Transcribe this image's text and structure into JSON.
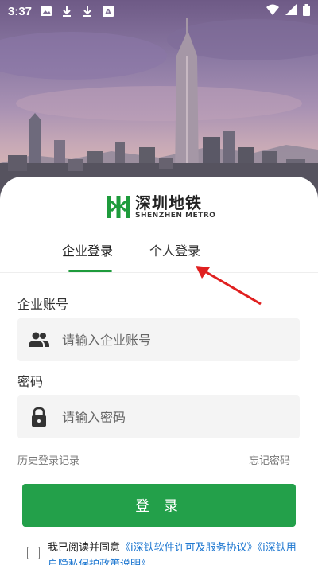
{
  "status_bar": {
    "time": "3:37"
  },
  "logo": {
    "name_cn": "深圳地铁",
    "name_en": "SHENZHEN METRO"
  },
  "tabs": [
    {
      "label": "企业登录",
      "active": true
    },
    {
      "label": "个人登录",
      "active": false
    }
  ],
  "form": {
    "account_label": "企业账号",
    "account_placeholder": "请输入企业账号",
    "password_label": "密码",
    "password_placeholder": "请输入密码"
  },
  "links": {
    "history": "历史登录记录",
    "forgot": "忘记密码"
  },
  "login_button": "登 录",
  "agreement": {
    "prefix": "我已阅读并同意",
    "link1": "《i深铁软件许可及服务协议》",
    "link2": "《i深铁用户隐私保护政策说明》"
  },
  "colors": {
    "accent": "#23a04a",
    "link": "#1f78d1",
    "annotation": "#e02020"
  },
  "icons": [
    "image-icon",
    "download-icon",
    "download-icon",
    "font-icon",
    "wifi-icon",
    "signal-icon",
    "battery-icon",
    "user-group-icon",
    "lock-icon"
  ]
}
